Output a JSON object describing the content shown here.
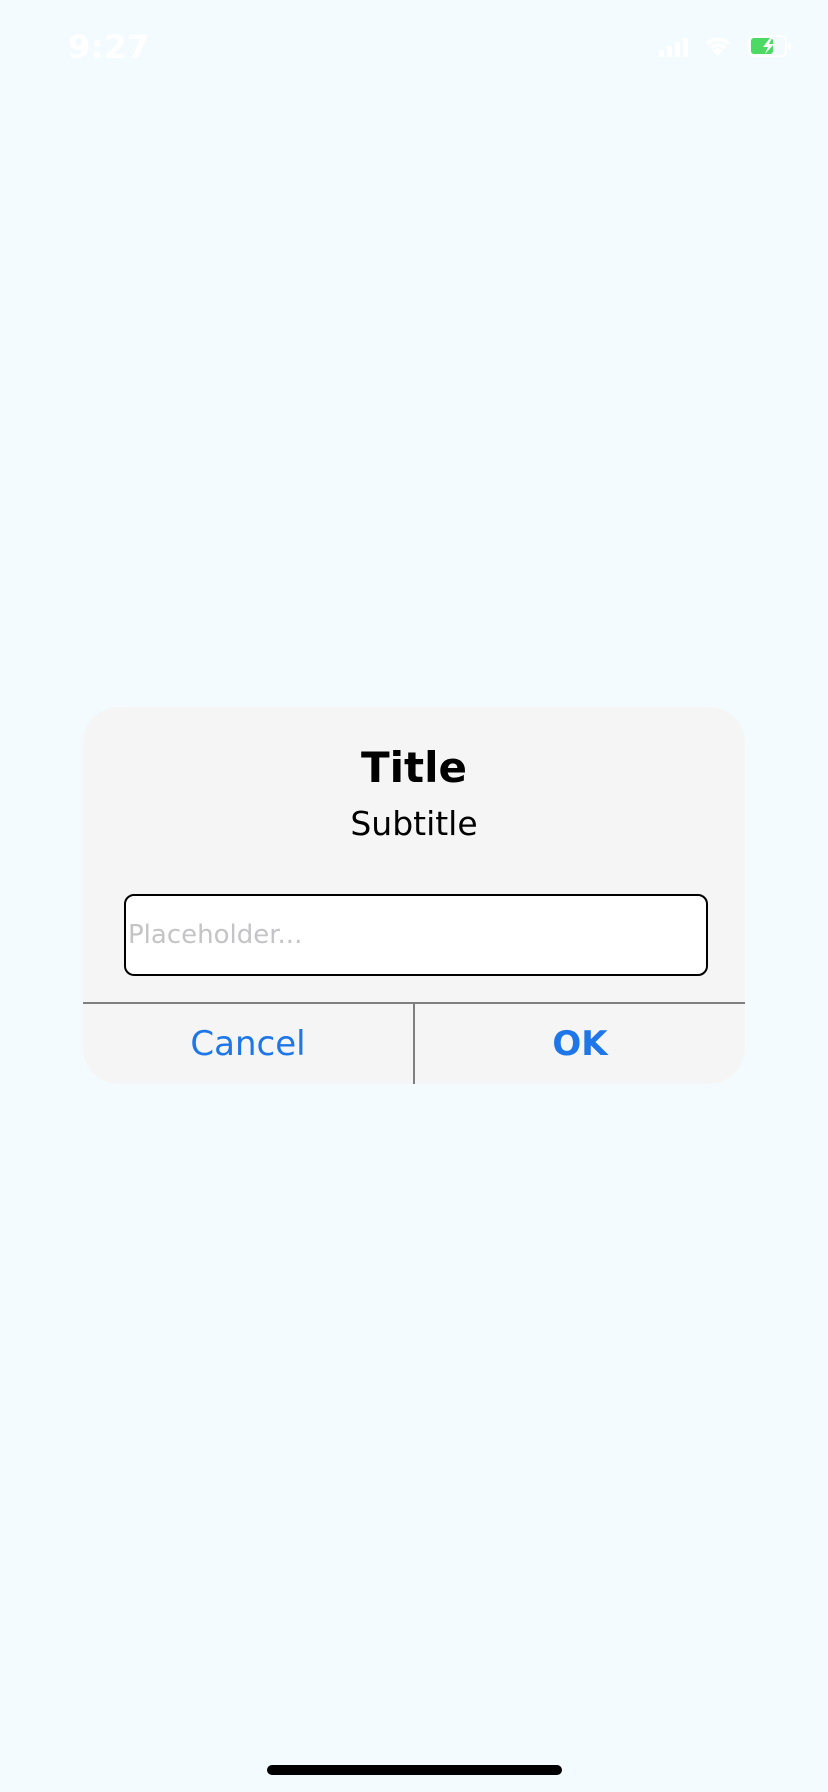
{
  "status_bar": {
    "time": "9:27",
    "icons": [
      "signal-icon",
      "wifi-icon",
      "battery-charging-icon"
    ],
    "battery_color": "#4cd964"
  },
  "dialog": {
    "title": "Title",
    "subtitle": "Subtitle",
    "input": {
      "value": "",
      "placeholder": "Placeholder..."
    },
    "cancel_label": "Cancel",
    "ok_label": "OK",
    "accent_color": "#1e76e8"
  }
}
